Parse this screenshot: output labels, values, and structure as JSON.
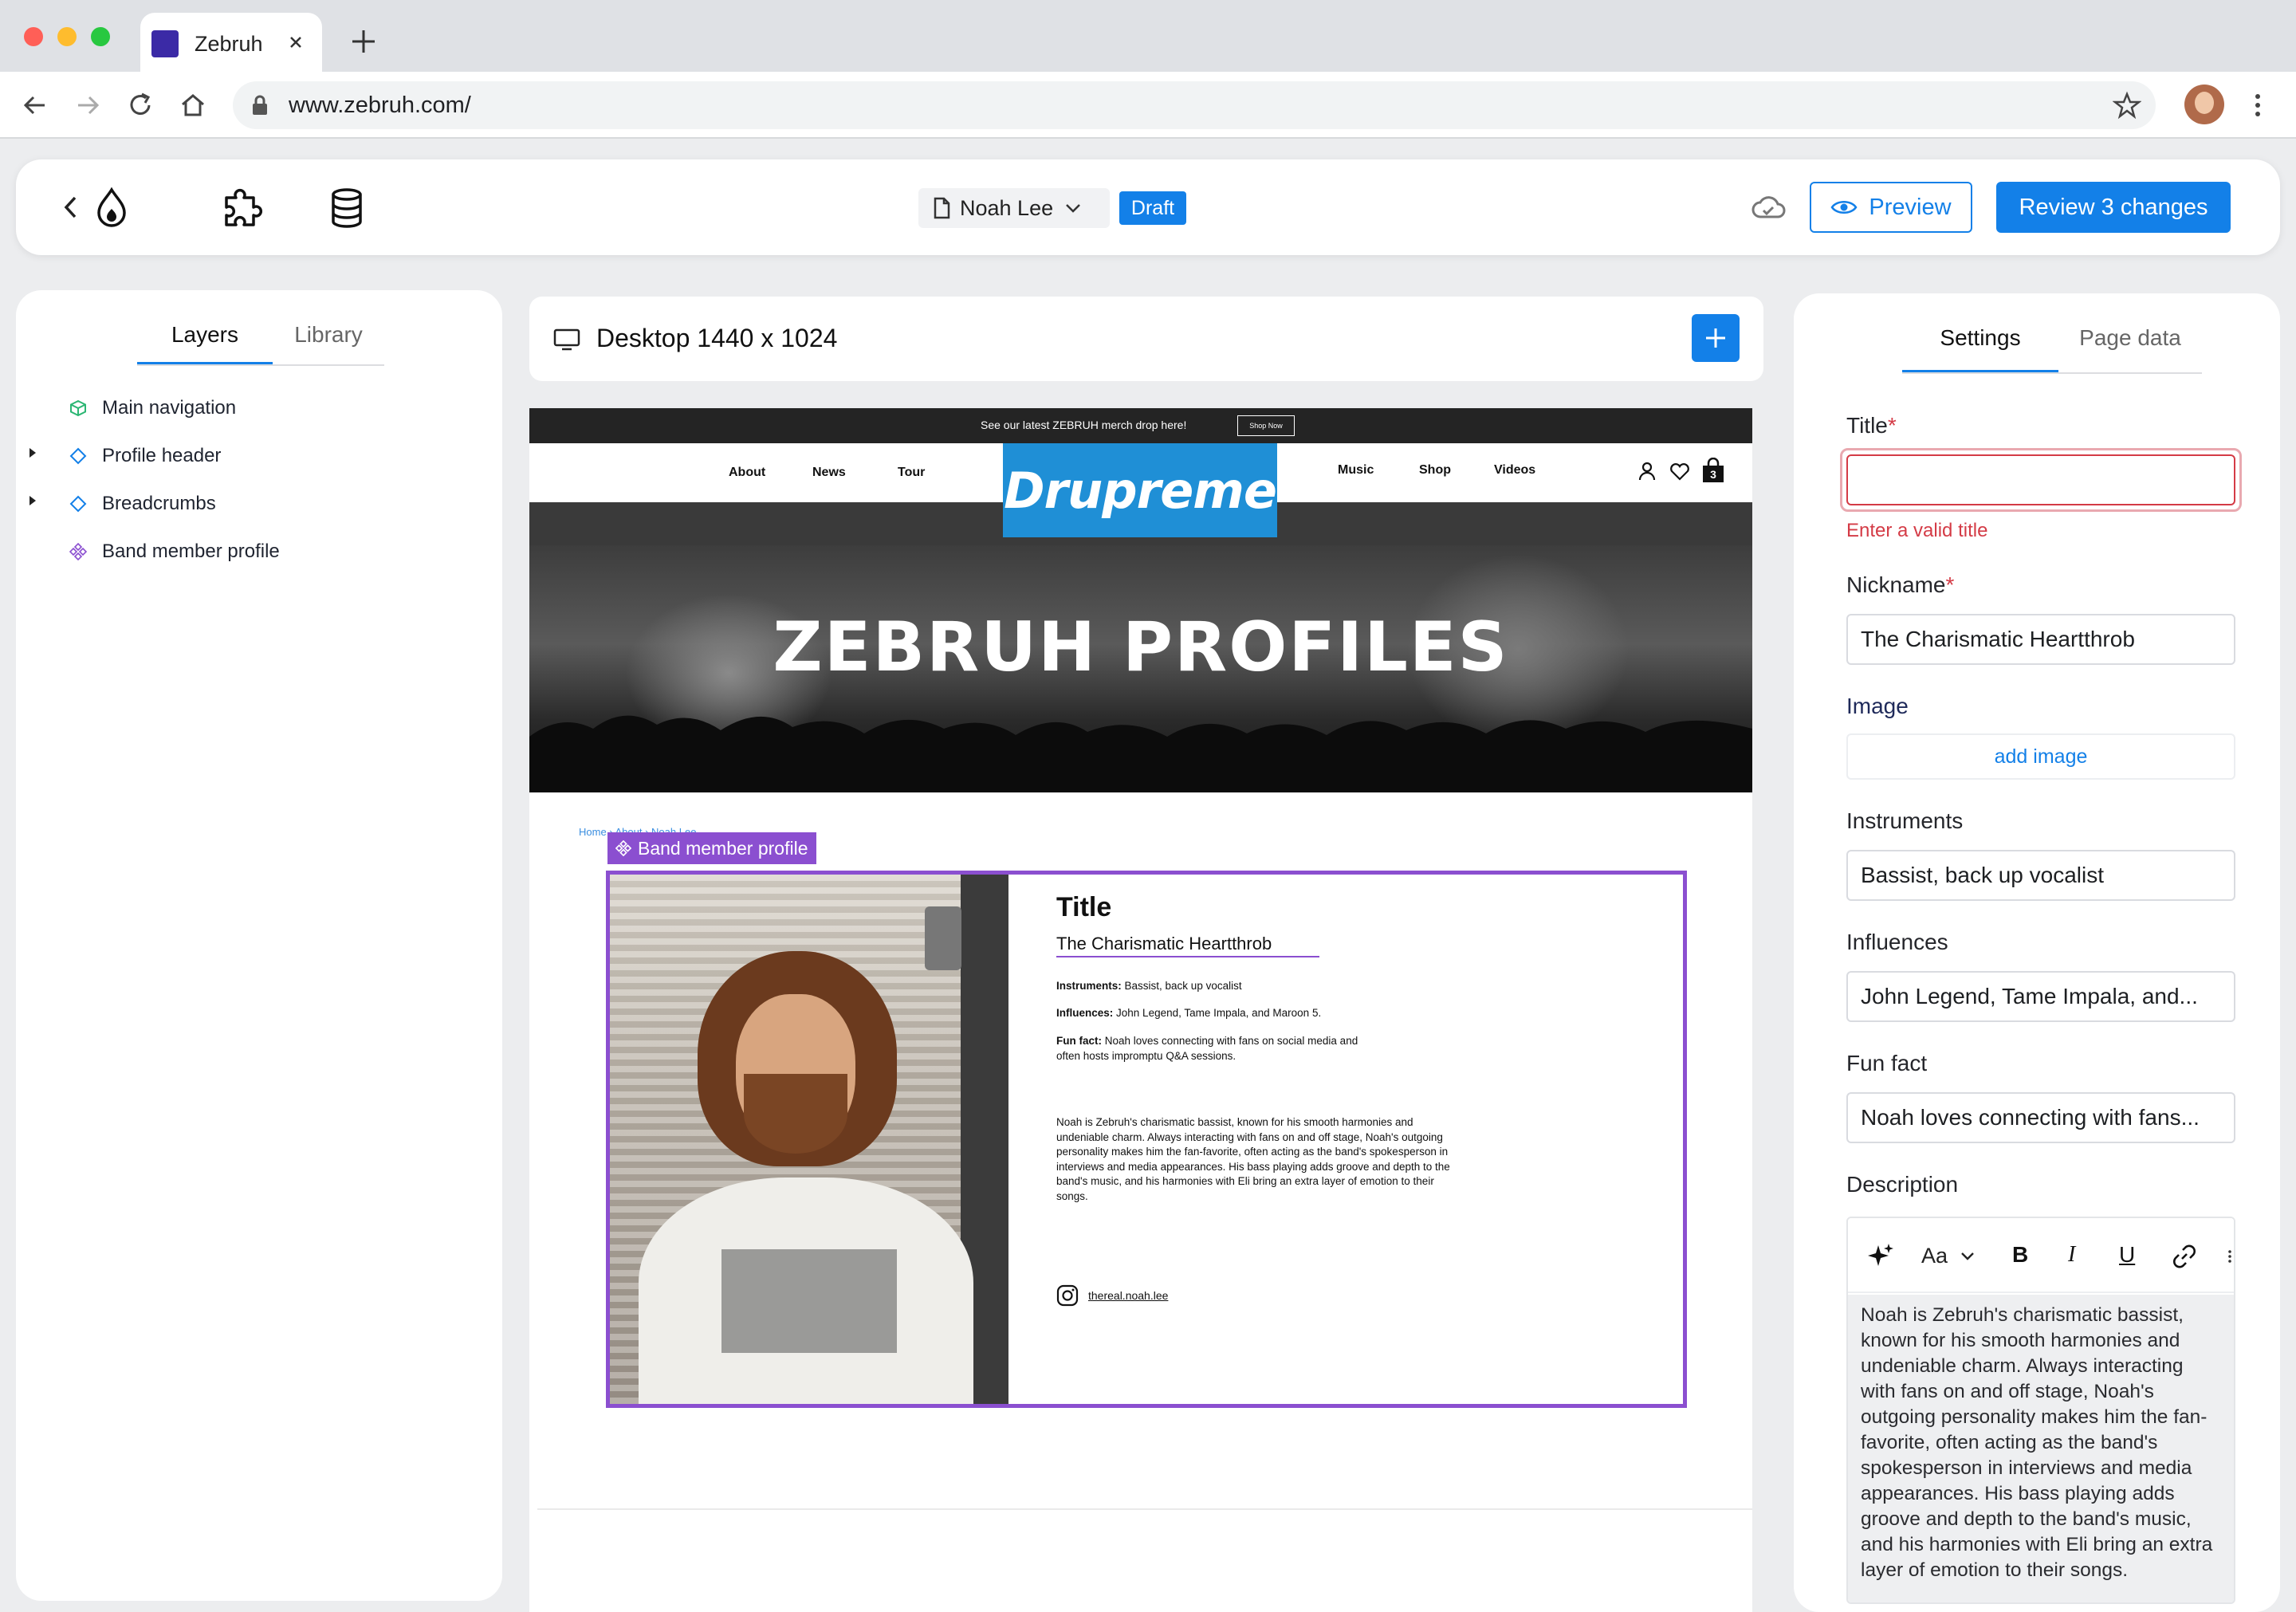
{
  "browser": {
    "tab_title": "Zebruh",
    "url": "www.zebruh.com/"
  },
  "toolbar": {
    "page_name": "Noah Lee",
    "status_badge": "Draft",
    "preview_label": "Preview",
    "review_label": "Review 3 changes"
  },
  "left_panel": {
    "tabs": [
      "Layers",
      "Library"
    ],
    "layers": [
      {
        "label": "Main navigation",
        "icon": "box-icon"
      },
      {
        "label": "Profile header",
        "icon": "diamond-icon"
      },
      {
        "label": "Breadcrumbs",
        "icon": "diamond-icon"
      },
      {
        "label": "Band member profile",
        "icon": "component-icon"
      }
    ]
  },
  "canvas": {
    "viewport_label": "Desktop 1440 x 1024",
    "site": {
      "promo_text": "See our latest ZEBRUH merch drop here!",
      "promo_button": "Shop Now",
      "nav_left": [
        "About",
        "News",
        "Tour"
      ],
      "nav_right": [
        "Music",
        "Shop",
        "Videos"
      ],
      "logo": "Drupreme",
      "cart_count": "3",
      "hero_title": "ZEBRUH PROFILES",
      "breadcrumb": "Home › About › Noah Lee",
      "component_tag": "Band member profile",
      "profile": {
        "title": "Title",
        "nickname": "The Charismatic Heartthrob",
        "instruments_label": "Instruments:",
        "instruments": "Bassist, back up vocalist",
        "influences_label": "Influences:",
        "influences": "John Legend, Tame Impala, and Maroon 5.",
        "fun_fact_label": "Fun fact:",
        "fun_fact_line1": "Noah loves connecting with fans on social media and",
        "fun_fact_line2": "often hosts impromptu Q&A sessions.",
        "bio_lines": [
          "Noah is Zebruh's charismatic bassist, known for his smooth harmonies and",
          "undeniable charm. Always interacting with fans on and off stage, Noah's outgoing",
          "personality makes him the fan-favorite, often acting as the band's spokesperson in",
          "interviews and media appearances. His bass playing adds groove and depth to the",
          "band's music, and his harmonies with Eli bring an extra layer of emotion to their",
          "songs."
        ],
        "instagram": "thereal.noah.lee"
      }
    }
  },
  "right_panel": {
    "tabs": [
      "Settings",
      "Page data"
    ],
    "title_label": "Title",
    "title_value": "",
    "title_error": "Enter a valid title",
    "nickname_label": "Nickname",
    "nickname_value": "The Charismatic Heartthrob",
    "image_label": "Image",
    "add_image": "add image",
    "instruments_label": "Instruments",
    "instruments_value": "Bassist, back up vocalist",
    "influences_label": "Influences",
    "influences_value": "John Legend, Tame Impala, and...",
    "fun_fact_label": "Fun fact",
    "fun_fact_value": "Noah loves connecting with fans...",
    "description_label": "Description",
    "font_menu": "Aa",
    "description_lines": [
      "Noah is Zebruh's charismatic bassist,",
      "known for his smooth harmonies and",
      "undeniable charm. Always interacting",
      "with fans on and off stage, Noah's",
      "outgoing personality makes him the fan-",
      "favorite, often acting as the band's",
      "spokesperson in interviews and media",
      "appearances. His bass playing adds",
      "groove and depth to the band's music,",
      "and his harmonies with Eli bring an extra",
      "layer of emotion to their songs."
    ]
  },
  "colors": {
    "accent_blue": "#1380e8",
    "component_purple": "#8b4fd0",
    "error_red": "#d43b46",
    "logo_blue": "#1f8fd6"
  }
}
